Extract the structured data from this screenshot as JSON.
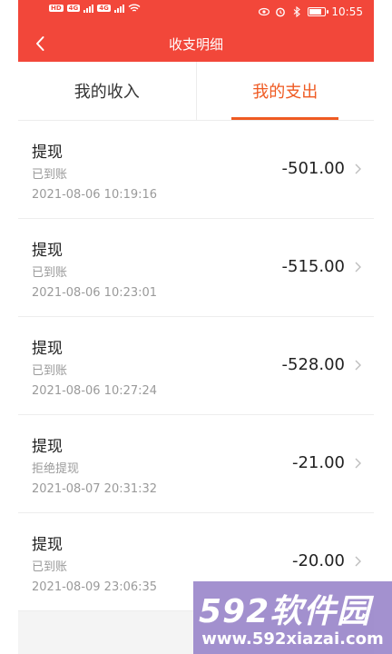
{
  "status_bar": {
    "chips": [
      "HD",
      "HD",
      "4G",
      "4G"
    ],
    "time": "10:55",
    "battery_level": 0.85,
    "icons": [
      "eye-icon",
      "alarm-icon",
      "bluetooth-icon",
      "battery-icon",
      "wifi-icon",
      "signal-icon"
    ]
  },
  "header": {
    "title": "收支明细",
    "back_icon": "chevron-left-icon"
  },
  "tabs": [
    {
      "label": "我的收入",
      "active": false
    },
    {
      "label": "我的支出",
      "active": true
    }
  ],
  "records": [
    {
      "type": "提现",
      "status": "已到账",
      "time": "2021-08-06 10:19:16",
      "amount": "-501.00"
    },
    {
      "type": "提现",
      "status": "已到账",
      "time": "2021-08-06 10:23:01",
      "amount": "-515.00"
    },
    {
      "type": "提现",
      "status": "已到账",
      "time": "2021-08-06 10:27:24",
      "amount": "-528.00"
    },
    {
      "type": "提现",
      "status": "拒绝提现",
      "time": "2021-08-07 20:31:32",
      "amount": "-21.00"
    },
    {
      "type": "提现",
      "status": "已到账",
      "time": "2021-08-09 23:06:35",
      "amount": "-20.00"
    }
  ],
  "watermark": {
    "logo": "592软件园",
    "url": "www.592xiazai.com"
  },
  "colors": {
    "header_bg": "#f2473a",
    "accent": "#ef5a22",
    "muted_text": "#9a9a9a"
  }
}
